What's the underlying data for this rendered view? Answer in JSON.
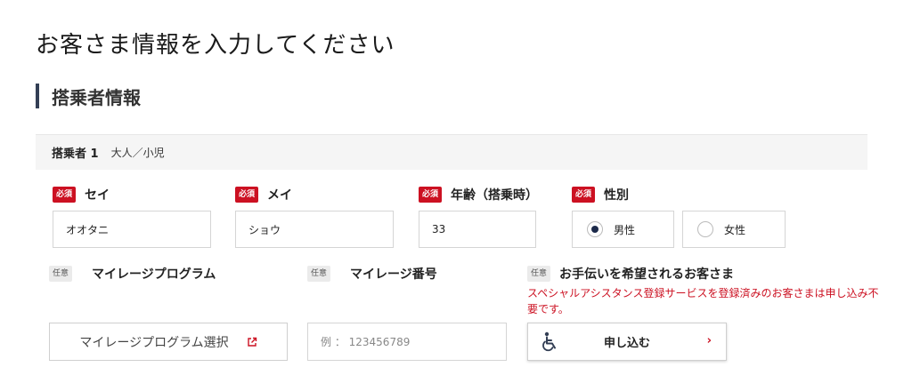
{
  "page": {
    "title": "お客さま情報を入力してください"
  },
  "section": {
    "title": "搭乗者情報"
  },
  "passenger": {
    "label": "搭乗者 1",
    "type": "大人／小児"
  },
  "badges": {
    "required": "必須",
    "optional": "任意"
  },
  "fields": {
    "sei": {
      "label": "セイ",
      "value": "オオタニ"
    },
    "mei": {
      "label": "メイ",
      "value": "ショウ"
    },
    "age": {
      "label": "年齢（搭乗時）",
      "value": "33"
    },
    "gender": {
      "label": "性別",
      "options": [
        "男性",
        "女性"
      ],
      "selected": "男性"
    },
    "mileage_program": {
      "label": "マイレージプログラム",
      "button": "マイレージプログラム選択"
    },
    "mileage_number": {
      "label": "マイレージ番号",
      "placeholder": "例 ： 123456789"
    },
    "assistance": {
      "label": "お手伝いを希望されるお客さま",
      "notice": "スペシャルアシスタンス登録サービスを登録済みのお客さまは申し込み不要です。",
      "button": "申し込む"
    }
  },
  "colors": {
    "required_badge": "#cc1122",
    "optional_badge": "#ebebeb",
    "accent_bar": "#333f55",
    "radio_selected": "#1c2a4a"
  },
  "icons": {
    "external_link": "external-link-icon",
    "wheelchair": "wheelchair-icon",
    "chevron": "chevron-right-icon"
  }
}
